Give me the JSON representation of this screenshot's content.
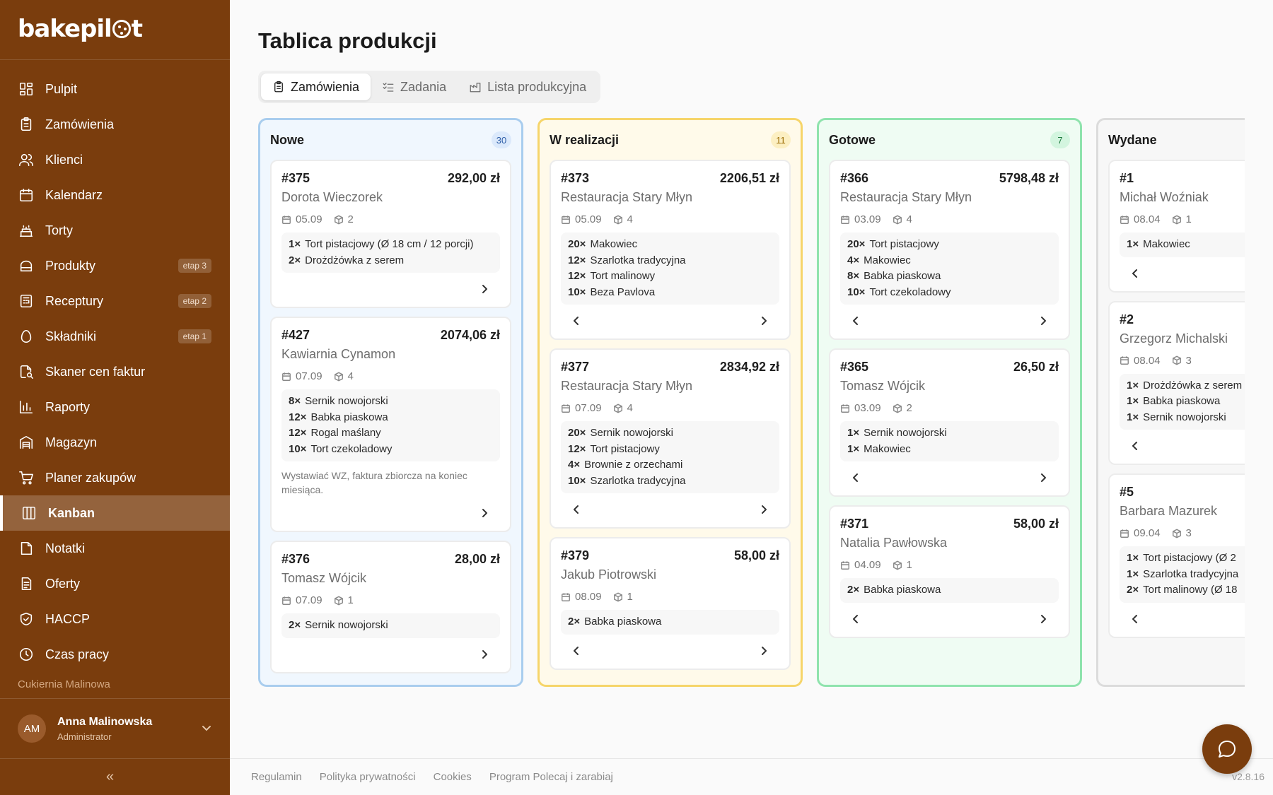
{
  "brand": {
    "logo_text_left": "bakepil",
    "logo_text_right": "t"
  },
  "sidebar": {
    "items": [
      {
        "label": "Pulpit",
        "icon": "dashboard-icon",
        "badge": ""
      },
      {
        "label": "Zamówienia",
        "icon": "clipboard-icon",
        "badge": ""
      },
      {
        "label": "Klienci",
        "icon": "users-icon",
        "badge": ""
      },
      {
        "label": "Kalendarz",
        "icon": "calendar-icon",
        "badge": ""
      },
      {
        "label": "Torty",
        "icon": "cake-icon",
        "badge": ""
      },
      {
        "label": "Produkty",
        "icon": "bread-icon",
        "badge": "etap 3"
      },
      {
        "label": "Receptury",
        "icon": "recipe-icon",
        "badge": "etap 2"
      },
      {
        "label": "Składniki",
        "icon": "egg-icon",
        "badge": "etap 1"
      },
      {
        "label": "Skaner cen faktur",
        "icon": "scan-file-icon",
        "badge": ""
      },
      {
        "label": "Raporty",
        "icon": "bar-chart-icon",
        "badge": ""
      },
      {
        "label": "Magazyn",
        "icon": "warehouse-icon",
        "badge": ""
      },
      {
        "label": "Planer zakupów",
        "icon": "cart-icon",
        "badge": ""
      },
      {
        "label": "Kanban",
        "icon": "kanban-icon",
        "badge": "",
        "active": true
      },
      {
        "label": "Notatki",
        "icon": "note-icon",
        "badge": ""
      },
      {
        "label": "Oferty",
        "icon": "document-icon",
        "badge": ""
      },
      {
        "label": "HACCP",
        "icon": "shield-check-icon",
        "badge": ""
      },
      {
        "label": "Czas pracy",
        "icon": "clock-icon",
        "badge": ""
      }
    ],
    "company": "Cukiernia Malinowa",
    "user": {
      "initials": "AM",
      "name": "Anna Malinowska",
      "role": "Administrator"
    },
    "collapse": "«"
  },
  "main": {
    "title": "Tablica produkcji",
    "tabs": [
      {
        "label": "Zamówienia",
        "active": true
      },
      {
        "label": "Zadania",
        "active": false
      },
      {
        "label": "Lista produkcyjna",
        "active": false
      }
    ]
  },
  "columns": [
    {
      "title": "Nowe",
      "count": "30",
      "border": "#a9cdee",
      "bg": "#f0f7fe",
      "count_bg": "#dbe9fb",
      "count_color": "#2f5fa8",
      "cards": [
        {
          "id": "#375",
          "amount": "292,00 zł",
          "client": "Dorota Wieczorek",
          "date": "05.09",
          "pkgs": "2",
          "items": [
            {
              "q": "1×",
              "n": "Tort pistacjowy (Ø 18 cm / 12 porcji)"
            },
            {
              "q": "2×",
              "n": "Drożdżówka z serem"
            }
          ],
          "note": "",
          "prev": false,
          "next": true
        },
        {
          "id": "#427",
          "amount": "2074,06 zł",
          "client": "Kawiarnia Cynamon",
          "date": "07.09",
          "pkgs": "4",
          "items": [
            {
              "q": "8×",
              "n": "Sernik nowojorski"
            },
            {
              "q": "12×",
              "n": "Babka piaskowa"
            },
            {
              "q": "12×",
              "n": "Rogal maślany"
            },
            {
              "q": "10×",
              "n": "Tort czekoladowy"
            }
          ],
          "note": "Wystawiać WZ, faktura zbiorcza na koniec miesiąca.",
          "prev": false,
          "next": true
        },
        {
          "id": "#376",
          "amount": "28,00 zł",
          "client": "Tomasz Wójcik",
          "date": "07.09",
          "pkgs": "1",
          "items": [
            {
              "q": "2×",
              "n": "Sernik nowojorski"
            }
          ],
          "note": "",
          "prev": false,
          "next": true
        }
      ]
    },
    {
      "title": "W realizacji",
      "count": "11",
      "border": "#f6d56a",
      "bg": "#fffaea",
      "count_bg": "#fcefc2",
      "count_color": "#9a6a00",
      "cards": [
        {
          "id": "#373",
          "amount": "2206,51 zł",
          "client": "Restauracja Stary Młyn",
          "date": "05.09",
          "pkgs": "4",
          "items": [
            {
              "q": "20×",
              "n": "Makowiec"
            },
            {
              "q": "12×",
              "n": "Szarlotka tradycyjna"
            },
            {
              "q": "12×",
              "n": "Tort malinowy"
            },
            {
              "q": "10×",
              "n": "Beza Pavlova"
            }
          ],
          "note": "",
          "prev": true,
          "next": true
        },
        {
          "id": "#377",
          "amount": "2834,92 zł",
          "client": "Restauracja Stary Młyn",
          "date": "07.09",
          "pkgs": "4",
          "items": [
            {
              "q": "20×",
              "n": "Sernik nowojorski"
            },
            {
              "q": "12×",
              "n": "Tort pistacjowy"
            },
            {
              "q": "4×",
              "n": "Brownie z orzechami"
            },
            {
              "q": "10×",
              "n": "Szarlotka tradycyjna"
            }
          ],
          "note": "",
          "prev": true,
          "next": true
        },
        {
          "id": "#379",
          "amount": "58,00 zł",
          "client": "Jakub Piotrowski",
          "date": "08.09",
          "pkgs": "1",
          "items": [
            {
              "q": "2×",
              "n": "Babka piaskowa"
            }
          ],
          "note": "",
          "prev": true,
          "next": true
        }
      ]
    },
    {
      "title": "Gotowe",
      "count": "7",
      "border": "#8fe3ad",
      "bg": "#effcf3",
      "count_bg": "#d3f5df",
      "count_color": "#1f7a3f",
      "cards": [
        {
          "id": "#366",
          "amount": "5798,48 zł",
          "client": "Restauracja Stary Młyn",
          "date": "03.09",
          "pkgs": "4",
          "items": [
            {
              "q": "20×",
              "n": "Tort pistacjowy"
            },
            {
              "q": "4×",
              "n": "Makowiec"
            },
            {
              "q": "8×",
              "n": "Babka piaskowa"
            },
            {
              "q": "10×",
              "n": "Tort czekoladowy"
            }
          ],
          "note": "",
          "prev": true,
          "next": true
        },
        {
          "id": "#365",
          "amount": "26,50 zł",
          "client": "Tomasz Wójcik",
          "date": "03.09",
          "pkgs": "2",
          "items": [
            {
              "q": "1×",
              "n": "Sernik nowojorski"
            },
            {
              "q": "1×",
              "n": "Makowiec"
            }
          ],
          "note": "",
          "prev": true,
          "next": true
        },
        {
          "id": "#371",
          "amount": "58,00 zł",
          "client": "Natalia Pawłowska",
          "date": "04.09",
          "pkgs": "1",
          "items": [
            {
              "q": "2×",
              "n": "Babka piaskowa"
            }
          ],
          "note": "",
          "prev": true,
          "next": true
        }
      ]
    },
    {
      "title": "Wydane",
      "count": "",
      "border": "#dcdcdc",
      "bg": "#f7f7f7",
      "count_bg": "#e8e8e8",
      "count_color": "#555555",
      "cards": [
        {
          "id": "#1",
          "amount": "",
          "client": "Michał Woźniak",
          "date": "08.04",
          "pkgs": "1",
          "items": [
            {
              "q": "1×",
              "n": "Makowiec"
            }
          ],
          "note": "",
          "prev": true,
          "next": false
        },
        {
          "id": "#2",
          "amount": "",
          "client": "Grzegorz Michalski",
          "date": "08.04",
          "pkgs": "3",
          "items": [
            {
              "q": "1×",
              "n": "Drożdżówka z serem"
            },
            {
              "q": "1×",
              "n": "Babka piaskowa"
            },
            {
              "q": "1×",
              "n": "Sernik nowojorski"
            }
          ],
          "note": "",
          "prev": true,
          "next": false
        },
        {
          "id": "#5",
          "amount": "",
          "client": "Barbara Mazurek",
          "date": "09.04",
          "pkgs": "3",
          "items": [
            {
              "q": "1×",
              "n": "Tort pistacjowy (Ø 2"
            },
            {
              "q": "1×",
              "n": "Szarlotka tradycyjna"
            },
            {
              "q": "2×",
              "n": "Tort malinowy (Ø 18"
            }
          ],
          "note": "",
          "prev": true,
          "next": false
        }
      ]
    }
  ],
  "footer": {
    "links": [
      "Regulamin",
      "Polityka prywatności",
      "Cookies",
      "Program Polecaj i zarabiaj"
    ],
    "version": "v2.8.16"
  }
}
